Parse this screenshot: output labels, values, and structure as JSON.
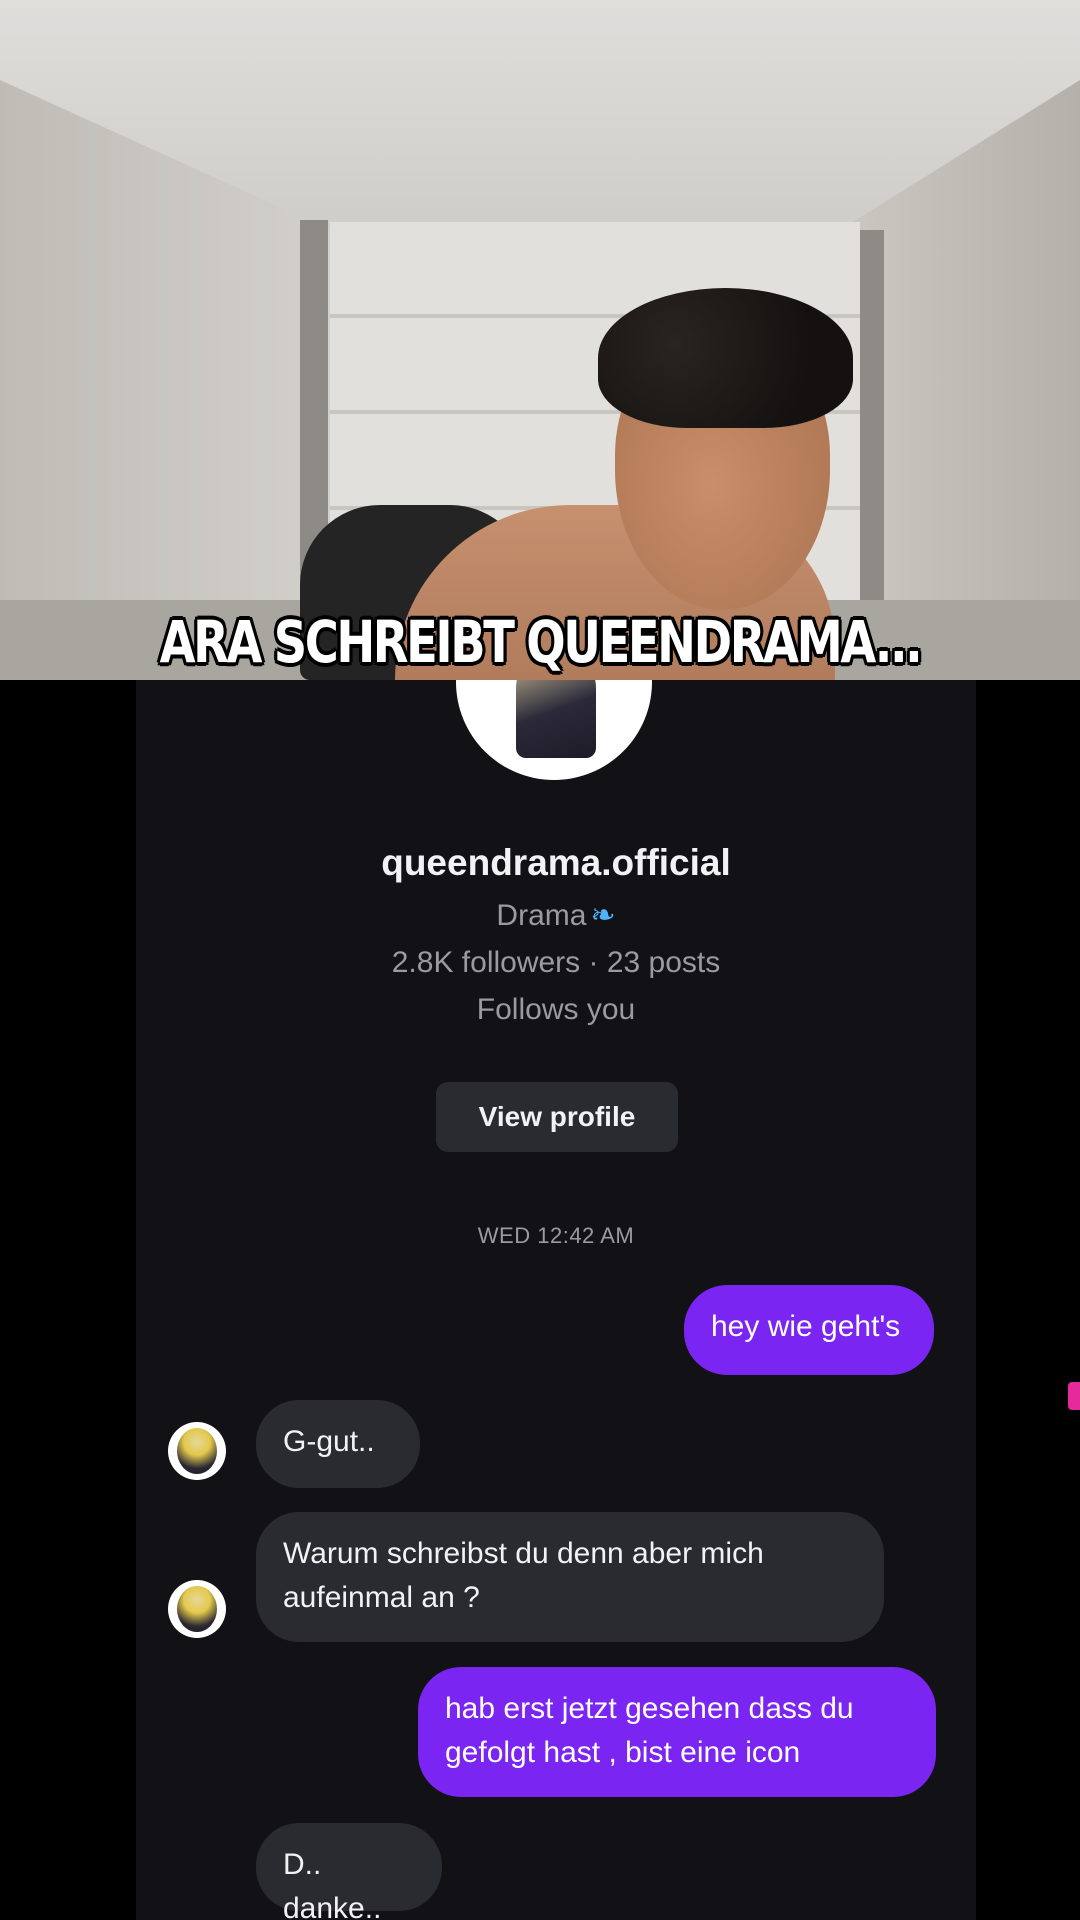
{
  "video": {
    "caption": "ARA SCHREIBT QUEENDRAMA..."
  },
  "profile": {
    "username": "queendrama.official",
    "bio": "Drama",
    "bio_emoji": "butterfly-icon",
    "stats": "2.8K followers · 23 posts",
    "follows_you": "Follows you",
    "view_profile_label": "View profile"
  },
  "chat": {
    "timestamp": "WED 12:42 AM",
    "messages": [
      {
        "from": "me",
        "text": "hey wie geht's"
      },
      {
        "from": "them",
        "text": "G-gut.."
      },
      {
        "from": "them",
        "text": "Warum schreibst du denn aber mich aufeinmal an ?"
      },
      {
        "from": "me",
        "text": "hab erst jetzt gesehen dass du gefolgt hast , bist eine icon"
      },
      {
        "from": "them",
        "text": "D.. danke.."
      }
    ]
  },
  "colors": {
    "chat_background": "#121216",
    "outgoing_bubble": "#7a25f2",
    "incoming_bubble": "#2a2b31",
    "secondary_text": "#9a9aa2"
  }
}
